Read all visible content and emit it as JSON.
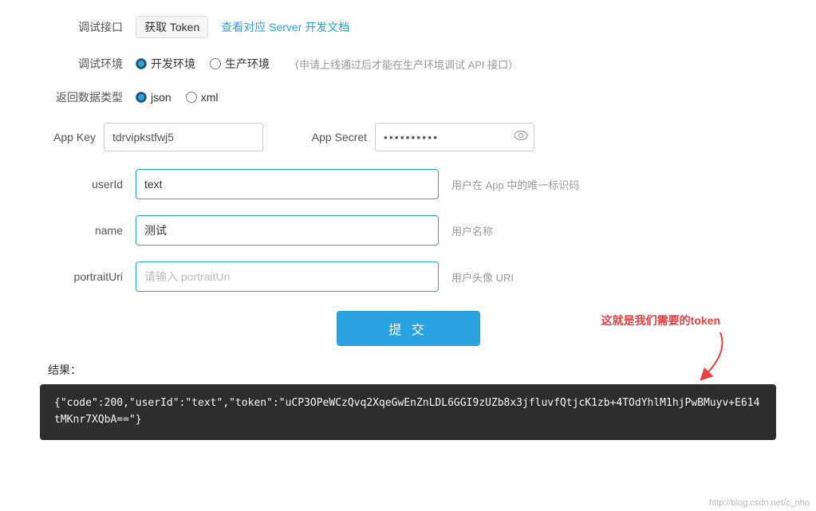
{
  "page": {
    "title": "调试接口"
  },
  "top_row": {
    "label": "调试接口",
    "badge_label": "获取 Token",
    "link_text": "查看对应 Server 开发文档",
    "link_href": "#"
  },
  "env_row": {
    "label": "调试环境",
    "options": [
      {
        "value": "dev",
        "label": "开发环境",
        "checked": true
      },
      {
        "value": "prod",
        "label": "生产环境",
        "checked": false
      }
    ],
    "note": "（申请上线通过后才能在生产环境调试 API 接口）"
  },
  "return_type_row": {
    "label": "返回数据类型",
    "options": [
      {
        "value": "json",
        "label": "json",
        "checked": true
      },
      {
        "value": "xml",
        "label": "xml",
        "checked": false
      }
    ]
  },
  "appkey": {
    "label": "App Key",
    "value": "tdrvipkstfwj5",
    "secret_label": "App Secret",
    "secret_value": "**********"
  },
  "fields": [
    {
      "name": "userId",
      "label": "userId",
      "value": "text",
      "placeholder": "",
      "hint": "用户在 App 中的唯一标识码"
    },
    {
      "name": "name",
      "label": "name",
      "value": "测试",
      "placeholder": "",
      "hint": "用户名称"
    },
    {
      "name": "portraitUri",
      "label": "portraitUri",
      "value": "",
      "placeholder": "请输入 portraitUri",
      "hint": "用户头像 URI"
    }
  ],
  "submit": {
    "label": "提 交"
  },
  "result": {
    "label": "结果：",
    "value": "{\"code\":200,\"userId\":\"text\",\"token\":\"uCP3OPeWCzQvq2XqeGwEnZnLDL6GGI9zUZb8x3jfluvfQtjcK1zb+4TOdYhlM1hjPwBMuyv+E614tMKnr7XQbA==\"}"
  },
  "annotation": {
    "text": "这就是我们需要的token"
  },
  "watermark": {
    "text": "http://blog.csdn.net/c_nho"
  }
}
